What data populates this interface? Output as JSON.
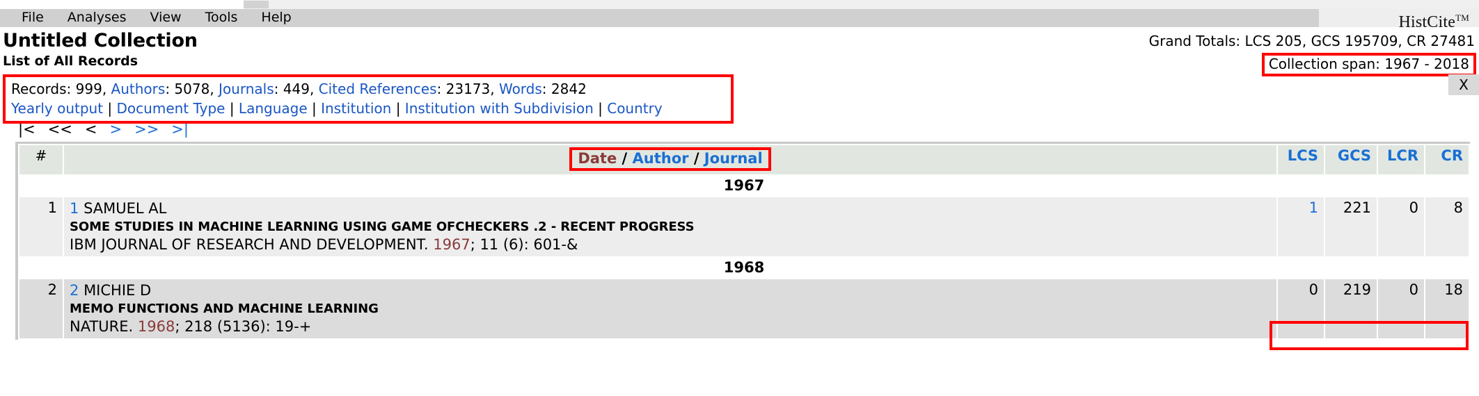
{
  "window": {
    "brand": "HistCite",
    "brand_tm": "TM"
  },
  "menu": {
    "items": [
      {
        "label": "File"
      },
      {
        "label": "Analyses"
      },
      {
        "label": "View"
      },
      {
        "label": "Tools"
      },
      {
        "label": "Help"
      }
    ]
  },
  "header": {
    "collection_title": "Untitled Collection",
    "subtitle": "List of All Records",
    "grand_totals": "Grand Totals: LCS 205, GCS 195709, CR 27481",
    "collection_span": "Collection span: 1967 - 2018"
  },
  "stats": {
    "close_label": "X",
    "counts": [
      {
        "label": "Records",
        "value": "999",
        "link": false
      },
      {
        "label": "Authors",
        "value": "5078",
        "link": true
      },
      {
        "label": "Journals",
        "value": "449",
        "link": true
      },
      {
        "label": "Cited References",
        "value": "23173",
        "link": true
      },
      {
        "label": "Words",
        "value": "2842",
        "link": true
      }
    ],
    "links": [
      "Yearly output",
      "Document Type",
      "Language",
      "Institution",
      "Institution with Subdivision",
      "Country"
    ]
  },
  "pager": {
    "first": "|<",
    "prev_fast": "<<",
    "prev": "<",
    "next": ">",
    "next_fast": ">>",
    "last": ">|"
  },
  "table": {
    "col_num": "#",
    "sort": {
      "date": "Date",
      "author": "Author",
      "journal": "Journal",
      "slash": "/"
    },
    "metrics": [
      "LCS",
      "GCS",
      "LCR",
      "CR"
    ],
    "groups": [
      {
        "year": "1967",
        "records": [
          {
            "num": "1",
            "index": "1",
            "author": "SAMUEL AL",
            "title": "SOME STUDIES IN MACHINE LEARNING USING GAME OFCHECKERS .2 - RECENT PROGRESS",
            "source_pre": "IBM JOURNAL OF RESEARCH AND DEVELOPMENT. ",
            "source_year": "1967",
            "source_post": "; 11 (6): 601-&",
            "lcs": "1",
            "lcs_link": true,
            "gcs": "221",
            "lcr": "0",
            "cr": "8"
          }
        ]
      },
      {
        "year": "1968",
        "records": [
          {
            "num": "2",
            "index": "2",
            "author": "MICHIE D",
            "title": "MEMO FUNCTIONS AND MACHINE LEARNING",
            "source_pre": "NATURE. ",
            "source_year": "1968",
            "source_post": "; 218 (5136): 19-+",
            "lcs": "0",
            "lcs_link": false,
            "gcs": "219",
            "lcr": "0",
            "cr": "18"
          }
        ]
      }
    ]
  },
  "colors": {
    "link": "#1a6fd4",
    "annotation": "#ff0000",
    "date_active": "#8b3a3a",
    "header_bg": "#e1e7e0"
  }
}
